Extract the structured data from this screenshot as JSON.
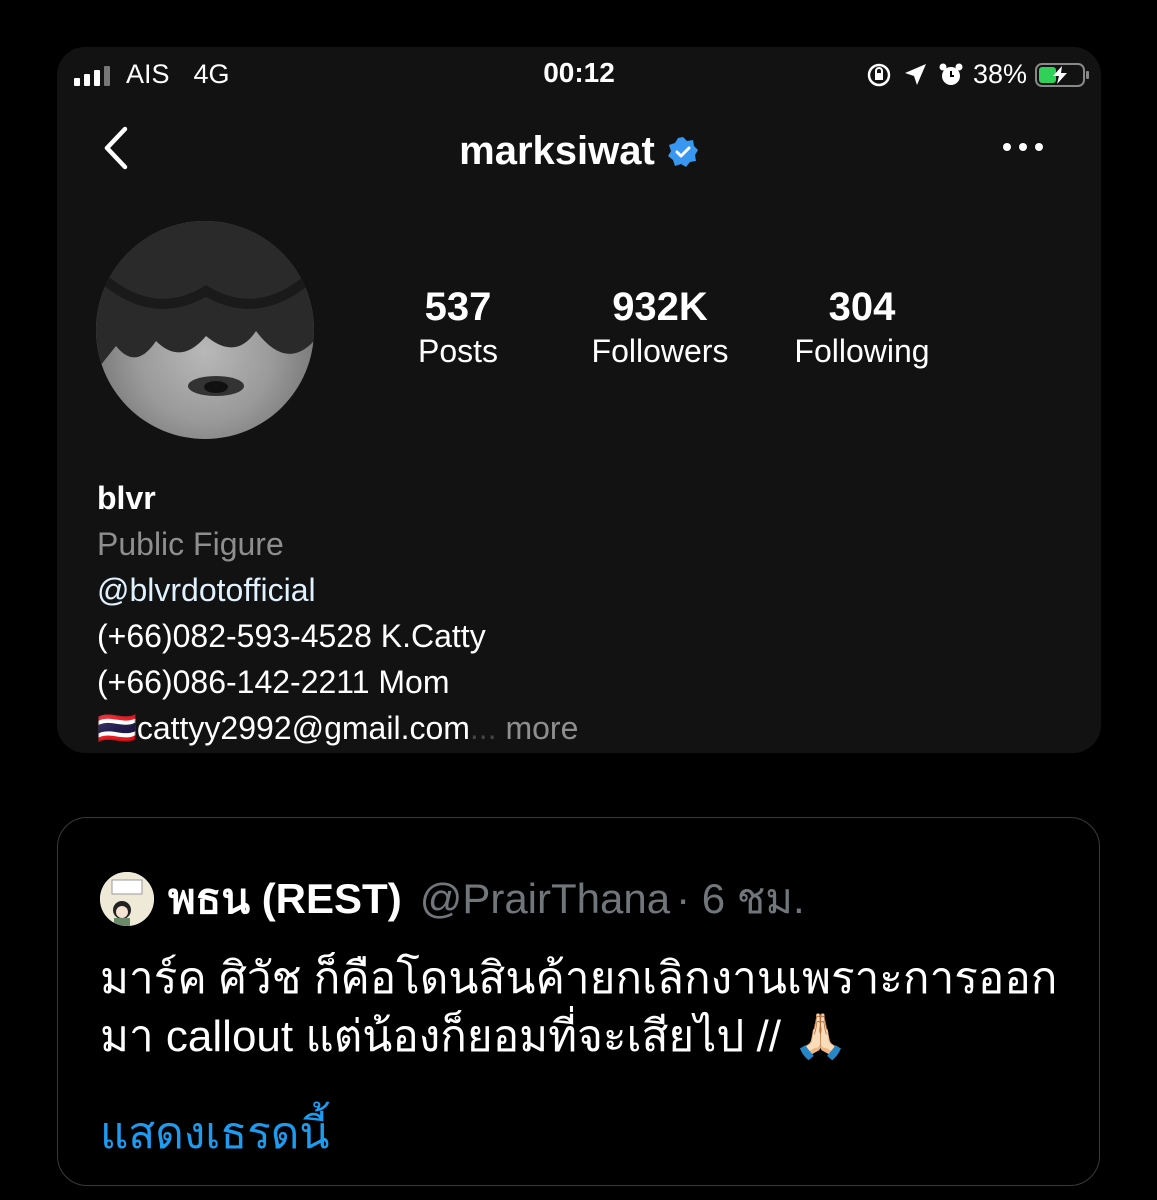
{
  "status_bar": {
    "carrier": "AIS",
    "network": "4G",
    "time": "00:12",
    "battery": "38%",
    "battery_level": 0.38,
    "icons": [
      "signal-icon",
      "orientation-lock-icon",
      "location-arrow-icon",
      "alarm-icon",
      "battery-icon"
    ]
  },
  "profile": {
    "username": "marksiwat",
    "verified": true,
    "posts_count": "537",
    "posts_label": "Posts",
    "followers_count": "932K",
    "followers_label": "Followers",
    "following_count": "304",
    "following_label": "Following",
    "bio_name": "blvr",
    "category": "Public Figure",
    "mention": "@blvrdotofficial",
    "bio_line1": "(+66)082-593-4528 K.Catty",
    "bio_line2": "(+66)086-142-2211 Mom",
    "bio_flag": "🇹🇭",
    "bio_email": "cattyy2992@gmail.com",
    "bio_ellipsis": "...",
    "more_label": "more"
  },
  "tweet": {
    "name": "พธน (REST)",
    "handle": "@PrairThana",
    "time": "· 6 ชม.",
    "text": "มาร์ค ศิวัช ก็คือโดนสินค้ายกเลิกงานเพราะการออกมา callout แต่น้องก็ยอมที่จะเสียไป // 🙏🏻",
    "show_thread": "แสดงเธรดนี้",
    "colors": {
      "link": "#1d9bf0",
      "handle": "#71767b"
    }
  }
}
